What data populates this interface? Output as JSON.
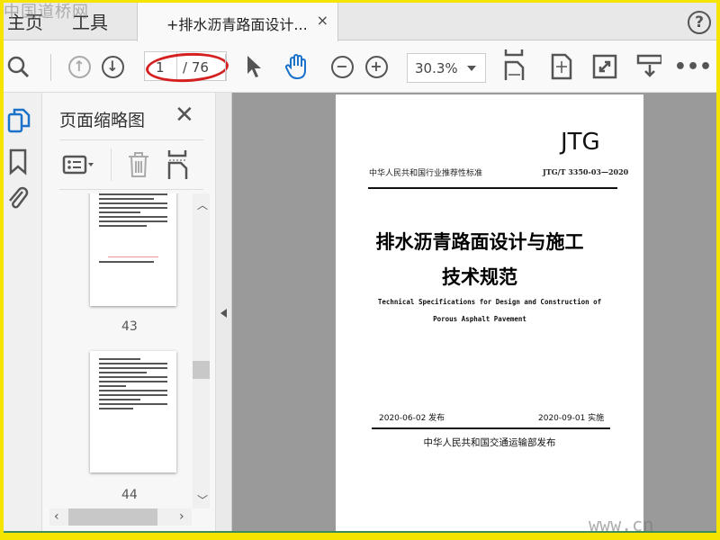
{
  "tabs": {
    "home": "主页",
    "tools": "工具",
    "document": "+排水沥青路面设计...",
    "close": "×",
    "help": "?"
  },
  "toolbar": {
    "current_page": "1",
    "total_pages": "/ 76",
    "zoom": "30.3%"
  },
  "panel": {
    "title": "页面缩略图",
    "thumbnails": [
      {
        "label": "43"
      },
      {
        "label": "44"
      }
    ]
  },
  "document": {
    "logo": "JTG",
    "category": "中华人民共和国行业推荐性标准",
    "code": "JTG/T 3350-03—2020",
    "title_line1": "排水沥青路面设计与施工",
    "title_line2": "技术规范",
    "en_line1": "Technical Specifications for Design and Construction of",
    "en_line2": "Porous Asphalt Pavement",
    "issue_date": "2020-06-02 发布",
    "effective_date": "2020-09-01 实施",
    "publisher": "中华人民共和国交通运输部发布"
  },
  "watermark": {
    "top": "中国道桥网",
    "bottom": "www.cn"
  },
  "colors": {
    "accent": "#1a73c8",
    "annotation": "#d42020",
    "frame": "#f5e400"
  }
}
